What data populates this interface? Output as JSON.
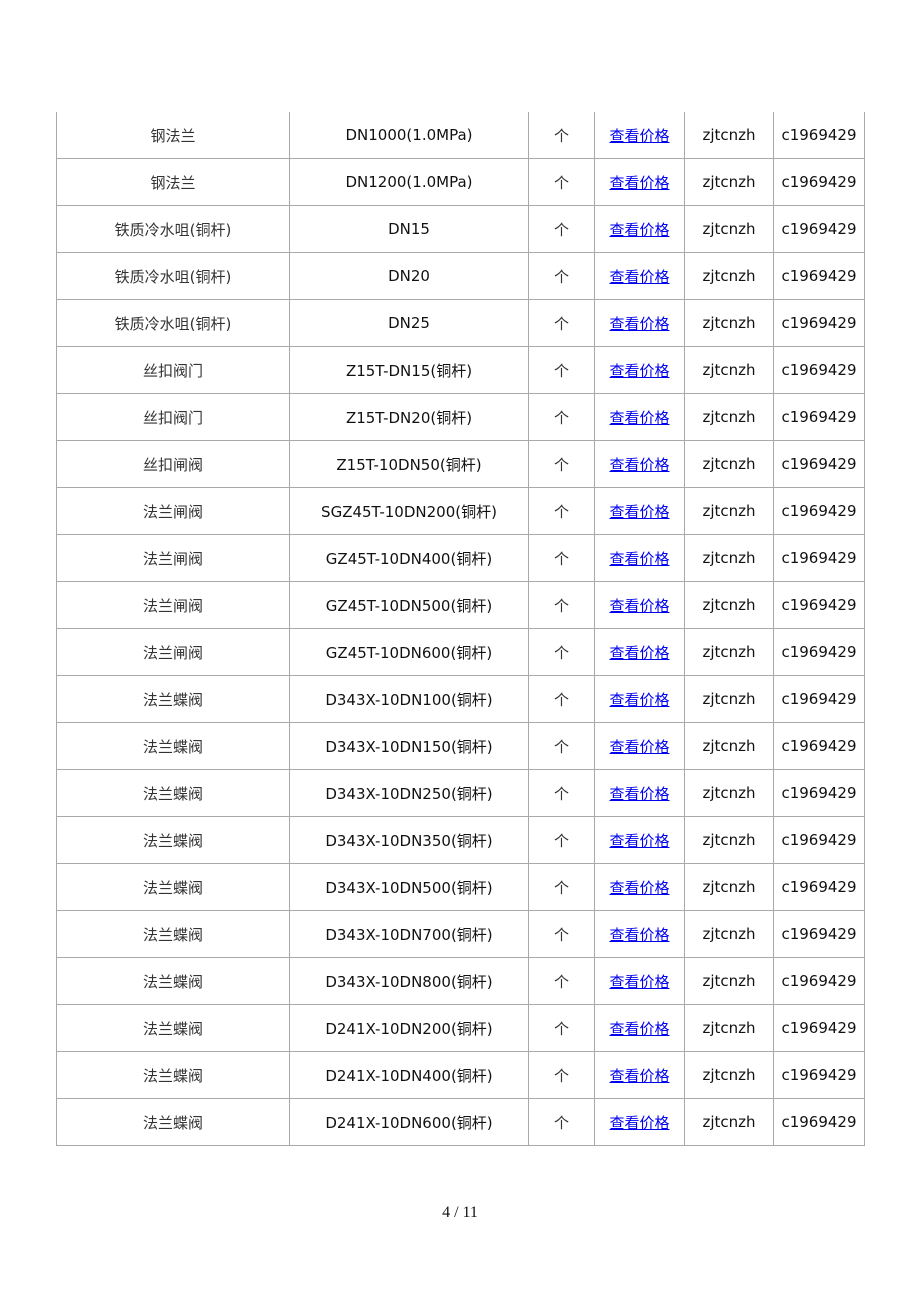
{
  "table": {
    "link_color": "#0000ee",
    "rows": [
      {
        "name": "钢法兰",
        "spec": "DN1000(1.0MPa)",
        "unit": "个",
        "link": "查看价格",
        "user": "zjtcnzh",
        "code": "c1969429"
      },
      {
        "name": "钢法兰",
        "spec": "DN1200(1.0MPa)",
        "unit": "个",
        "link": "查看价格",
        "user": "zjtcnzh",
        "code": "c1969429"
      },
      {
        "name": "铁质冷水咀(铜杆)",
        "spec": "DN15",
        "unit": "个",
        "link": "查看价格",
        "user": "zjtcnzh",
        "code": "c1969429"
      },
      {
        "name": "铁质冷水咀(铜杆)",
        "spec": "DN20",
        "unit": "个",
        "link": "查看价格",
        "user": "zjtcnzh",
        "code": "c1969429"
      },
      {
        "name": "铁质冷水咀(铜杆)",
        "spec": "DN25",
        "unit": "个",
        "link": "查看价格",
        "user": "zjtcnzh",
        "code": "c1969429"
      },
      {
        "name": "丝扣阀门",
        "spec": "Z15T-DN15(铜杆)",
        "unit": "个",
        "link": "查看价格",
        "user": "zjtcnzh",
        "code": "c1969429"
      },
      {
        "name": "丝扣阀门",
        "spec": "Z15T-DN20(铜杆)",
        "unit": "个",
        "link": "查看价格",
        "user": "zjtcnzh",
        "code": "c1969429"
      },
      {
        "name": "丝扣闸阀",
        "spec": "Z15T-10DN50(铜杆)",
        "unit": "个",
        "link": "查看价格",
        "user": "zjtcnzh",
        "code": "c1969429"
      },
      {
        "name": "法兰闸阀",
        "spec": "SGZ45T-10DN200(铜杆)",
        "unit": "个",
        "link": "查看价格",
        "user": "zjtcnzh",
        "code": "c1969429"
      },
      {
        "name": "法兰闸阀",
        "spec": "GZ45T-10DN400(铜杆)",
        "unit": "个",
        "link": "查看价格",
        "user": "zjtcnzh",
        "code": "c1969429"
      },
      {
        "name": "法兰闸阀",
        "spec": "GZ45T-10DN500(铜杆)",
        "unit": "个",
        "link": "查看价格",
        "user": "zjtcnzh",
        "code": "c1969429"
      },
      {
        "name": "法兰闸阀",
        "spec": "GZ45T-10DN600(铜杆)",
        "unit": "个",
        "link": "查看价格",
        "user": "zjtcnzh",
        "code": "c1969429"
      },
      {
        "name": "法兰蝶阀",
        "spec": "D343X-10DN100(铜杆)",
        "unit": "个",
        "link": "查看价格",
        "user": "zjtcnzh",
        "code": "c1969429"
      },
      {
        "name": "法兰蝶阀",
        "spec": "D343X-10DN150(铜杆)",
        "unit": "个",
        "link": "查看价格",
        "user": "zjtcnzh",
        "code": "c1969429"
      },
      {
        "name": "法兰蝶阀",
        "spec": "D343X-10DN250(铜杆)",
        "unit": "个",
        "link": "查看价格",
        "user": "zjtcnzh",
        "code": "c1969429"
      },
      {
        "name": "法兰蝶阀",
        "spec": "D343X-10DN350(铜杆)",
        "unit": "个",
        "link": "查看价格",
        "user": "zjtcnzh",
        "code": "c1969429"
      },
      {
        "name": "法兰蝶阀",
        "spec": "D343X-10DN500(铜杆)",
        "unit": "个",
        "link": "查看价格",
        "user": "zjtcnzh",
        "code": "c1969429"
      },
      {
        "name": "法兰蝶阀",
        "spec": "D343X-10DN700(铜杆)",
        "unit": "个",
        "link": "查看价格",
        "user": "zjtcnzh",
        "code": "c1969429"
      },
      {
        "name": "法兰蝶阀",
        "spec": "D343X-10DN800(铜杆)",
        "unit": "个",
        "link": "查看价格",
        "user": "zjtcnzh",
        "code": "c1969429"
      },
      {
        "name": "法兰蝶阀",
        "spec": "D241X-10DN200(铜杆)",
        "unit": "个",
        "link": "查看价格",
        "user": "zjtcnzh",
        "code": "c1969429"
      },
      {
        "name": "法兰蝶阀",
        "spec": "D241X-10DN400(铜杆)",
        "unit": "个",
        "link": "查看价格",
        "user": "zjtcnzh",
        "code": "c1969429"
      },
      {
        "name": "法兰蝶阀",
        "spec": "D241X-10DN600(铜杆)",
        "unit": "个",
        "link": "查看价格",
        "user": "zjtcnzh",
        "code": "c1969429"
      }
    ]
  },
  "footer": {
    "page_indicator": "4  / 11"
  }
}
